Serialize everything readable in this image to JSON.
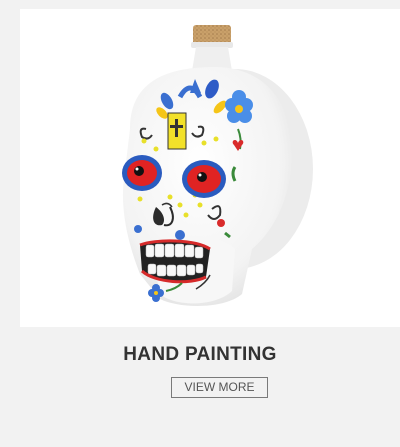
{
  "product": {
    "image_name": "sugar-skull-bottle",
    "title": "HAND PAINTING",
    "cta_label": "VIEW MORE"
  },
  "colors": {
    "page_background": "#f2f2f2",
    "image_background": "#ffffff",
    "title_color": "#333333",
    "button_border": "#7a7a7a",
    "button_text": "#555555"
  }
}
